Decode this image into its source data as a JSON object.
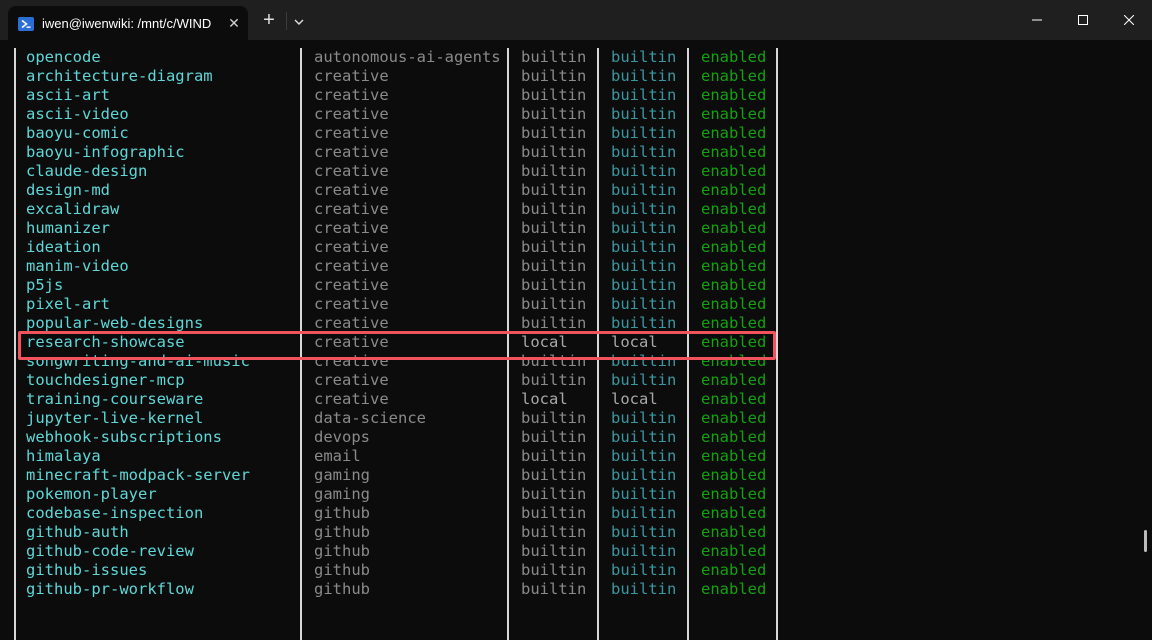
{
  "window": {
    "tab_title": "iwen@iwenwiki: /mnt/c/WIND",
    "tab_icon": "powershell-icon",
    "new_tab_label": "+",
    "close_tab_label": "✕",
    "colors": {
      "accent": "#f0535b",
      "name": "#5fd7d7",
      "status": "#13a10e",
      "trust": "#3a96a0"
    }
  },
  "rows": [
    {
      "name": "opencode",
      "category": "autonomous-ai-agents",
      "source": "builtin",
      "trust": "builtin",
      "status": "enabled"
    },
    {
      "name": "architecture-diagram",
      "category": "creative",
      "source": "builtin",
      "trust": "builtin",
      "status": "enabled"
    },
    {
      "name": "ascii-art",
      "category": "creative",
      "source": "builtin",
      "trust": "builtin",
      "status": "enabled"
    },
    {
      "name": "ascii-video",
      "category": "creative",
      "source": "builtin",
      "trust": "builtin",
      "status": "enabled"
    },
    {
      "name": "baoyu-comic",
      "category": "creative",
      "source": "builtin",
      "trust": "builtin",
      "status": "enabled"
    },
    {
      "name": "baoyu-infographic",
      "category": "creative",
      "source": "builtin",
      "trust": "builtin",
      "status": "enabled"
    },
    {
      "name": "claude-design",
      "category": "creative",
      "source": "builtin",
      "trust": "builtin",
      "status": "enabled"
    },
    {
      "name": "design-md",
      "category": "creative",
      "source": "builtin",
      "trust": "builtin",
      "status": "enabled"
    },
    {
      "name": "excalidraw",
      "category": "creative",
      "source": "builtin",
      "trust": "builtin",
      "status": "enabled"
    },
    {
      "name": "humanizer",
      "category": "creative",
      "source": "builtin",
      "trust": "builtin",
      "status": "enabled"
    },
    {
      "name": "ideation",
      "category": "creative",
      "source": "builtin",
      "trust": "builtin",
      "status": "enabled"
    },
    {
      "name": "manim-video",
      "category": "creative",
      "source": "builtin",
      "trust": "builtin",
      "status": "enabled"
    },
    {
      "name": "p5js",
      "category": "creative",
      "source": "builtin",
      "trust": "builtin",
      "status": "enabled"
    },
    {
      "name": "pixel-art",
      "category": "creative",
      "source": "builtin",
      "trust": "builtin",
      "status": "enabled"
    },
    {
      "name": "popular-web-designs",
      "category": "creative",
      "source": "builtin",
      "trust": "builtin",
      "status": "enabled"
    },
    {
      "name": "research-showcase",
      "category": "creative",
      "source": "local",
      "trust": "local",
      "status": "enabled"
    },
    {
      "name": "songwriting-and-ai-music",
      "category": "creative",
      "source": "builtin",
      "trust": "builtin",
      "status": "enabled"
    },
    {
      "name": "touchdesigner-mcp",
      "category": "creative",
      "source": "builtin",
      "trust": "builtin",
      "status": "enabled"
    },
    {
      "name": "training-courseware",
      "category": "creative",
      "source": "local",
      "trust": "local",
      "status": "enabled"
    },
    {
      "name": "jupyter-live-kernel",
      "category": "data-science",
      "source": "builtin",
      "trust": "builtin",
      "status": "enabled"
    },
    {
      "name": "webhook-subscriptions",
      "category": "devops",
      "source": "builtin",
      "trust": "builtin",
      "status": "enabled"
    },
    {
      "name": "himalaya",
      "category": "email",
      "source": "builtin",
      "trust": "builtin",
      "status": "enabled"
    },
    {
      "name": "minecraft-modpack-server",
      "category": "gaming",
      "source": "builtin",
      "trust": "builtin",
      "status": "enabled"
    },
    {
      "name": "pokemon-player",
      "category": "gaming",
      "source": "builtin",
      "trust": "builtin",
      "status": "enabled"
    },
    {
      "name": "codebase-inspection",
      "category": "github",
      "source": "builtin",
      "trust": "builtin",
      "status": "enabled"
    },
    {
      "name": "github-auth",
      "category": "github",
      "source": "builtin",
      "trust": "builtin",
      "status": "enabled"
    },
    {
      "name": "github-code-review",
      "category": "github",
      "source": "builtin",
      "trust": "builtin",
      "status": "enabled"
    },
    {
      "name": "github-issues",
      "category": "github",
      "source": "builtin",
      "trust": "builtin",
      "status": "enabled"
    },
    {
      "name": "github-pr-workflow",
      "category": "github",
      "source": "builtin",
      "trust": "builtin",
      "status": "enabled"
    }
  ],
  "highlighted_row": "research-showcase"
}
